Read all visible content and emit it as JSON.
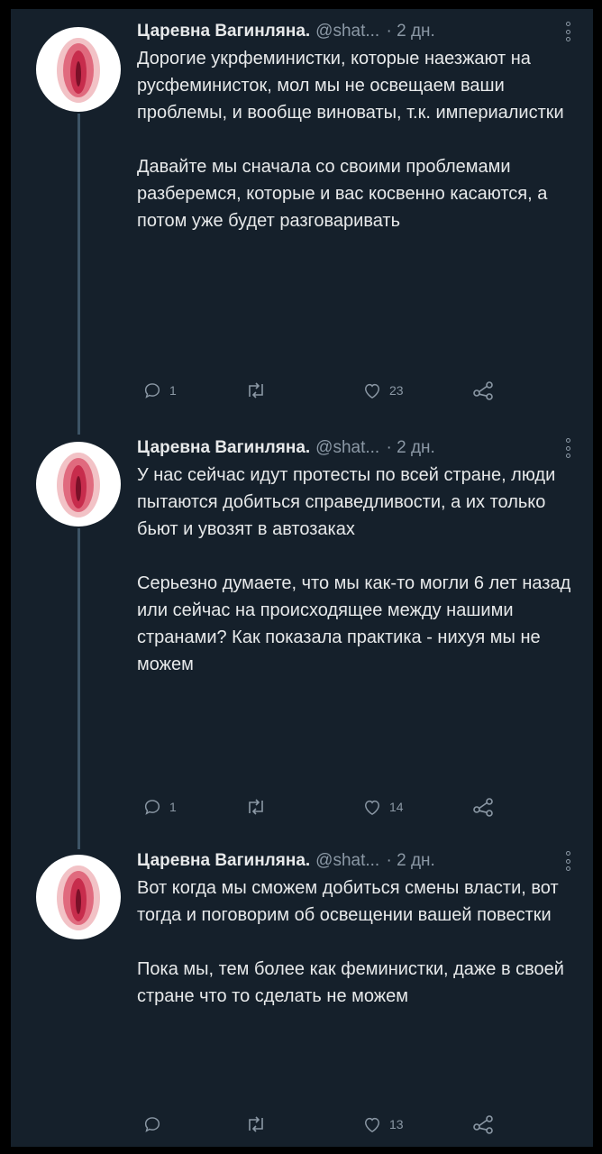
{
  "tweets": [
    {
      "name": "Царевна Вагинляна.",
      "handle": "@shat...",
      "time": "· 2 дн.",
      "paragraphs": [
        "Дорогие укрфеминистки, которые наезжают на русфеминисток, мол мы не освещаем ваши проблемы, и вообще виноваты, т.к. империалистки",
        "Давайте мы сначала со своими проблемами разберемся, которые и вас косвенно касаются, а потом уже будет разговаривать"
      ],
      "replies": "1",
      "retweets": "",
      "likes": "23"
    },
    {
      "name": "Царевна Вагинляна.",
      "handle": "@shat...",
      "time": "· 2 дн.",
      "paragraphs": [
        "У нас сейчас идут протесты по всей стране, люди пытаются добиться справедливости, а их только бьют и увозят в автозаках",
        "Серьезно думаете, что мы как-то могли 6 лет назад или сейчас на происходящее между нашими странами? Как показала практика - нихуя мы не можем"
      ],
      "replies": "1",
      "retweets": "",
      "likes": "14"
    },
    {
      "name": "Царевна Вагинляна.",
      "handle": "@shat...",
      "time": "· 2 дн.",
      "paragraphs": [
        "Вот когда мы сможем добиться смены власти, вот тогда и поговорим об освещении вашей повестки",
        "Пока мы, тем более как феминистки, даже в своей стране что то сделать не можем"
      ],
      "replies": "",
      "retweets": "",
      "likes": "13"
    }
  ],
  "icons": {
    "more": "more-icon",
    "reply": "reply-icon",
    "retweet": "retweet-icon",
    "like": "like-icon",
    "share": "share-icon",
    "avatar": "avatar-image"
  },
  "colors": {
    "background": "#15202b",
    "text": "#e7e9ea",
    "secondary": "#8b98a5",
    "thread_line": "#3d5466"
  }
}
